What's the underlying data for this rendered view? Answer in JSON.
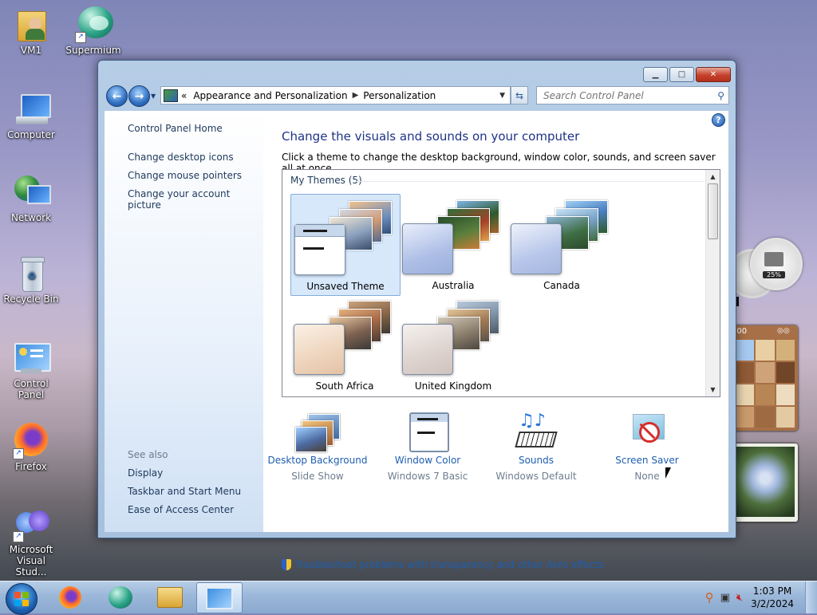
{
  "desktop": {
    "icons": [
      {
        "label": "VM1"
      },
      {
        "label": "Supermium"
      },
      {
        "label": "Computer"
      },
      {
        "label": "Network"
      },
      {
        "label": "Recycle Bin"
      },
      {
        "label": "Control Panel"
      },
      {
        "label": "Firefox"
      },
      {
        "label": "Microsoft Visual Stud..."
      }
    ],
    "gadgets": {
      "meter_value": "25%",
      "puzzle_time": ":00"
    }
  },
  "window": {
    "address": {
      "overflow": "«",
      "crumbs": [
        "Appearance and Personalization",
        "Personalization"
      ]
    },
    "search": {
      "placeholder": "Search Control Panel"
    },
    "left_pane": {
      "home": "Control Panel Home",
      "links": [
        "Change desktop icons",
        "Change mouse pointers",
        "Change your account picture"
      ],
      "see_also_label": "See also",
      "see_also": [
        "Display",
        "Taskbar and Start Menu",
        "Ease of Access Center"
      ]
    },
    "content": {
      "title": "Change the visuals and sounds on your computer",
      "subtitle": "Click a theme to change the desktop background, window color, sounds, and screen saver all at once.",
      "group_header": "My Themes (5)",
      "themes": [
        {
          "name": "Unsaved Theme",
          "selected": true
        },
        {
          "name": "Australia",
          "selected": false
        },
        {
          "name": "Canada",
          "selected": false
        },
        {
          "name": "South Africa",
          "selected": false
        },
        {
          "name": "United Kingdom",
          "selected": false
        }
      ],
      "settings": [
        {
          "label": "Desktop Background",
          "value": "Slide Show"
        },
        {
          "label": "Window Color",
          "value": "Windows 7 Basic"
        },
        {
          "label": "Sounds",
          "value": "Windows Default"
        },
        {
          "label": "Screen Saver",
          "value": "None"
        }
      ],
      "troubleshoot": "Troubleshoot problems with transparency and other Aero effects"
    }
  },
  "taskbar": {
    "time": "1:03 PM",
    "date": "3/2/2024"
  },
  "colors": {
    "link": "#1e5eb0",
    "title": "#1e3287",
    "selected_bg": "#d7e8fb"
  }
}
